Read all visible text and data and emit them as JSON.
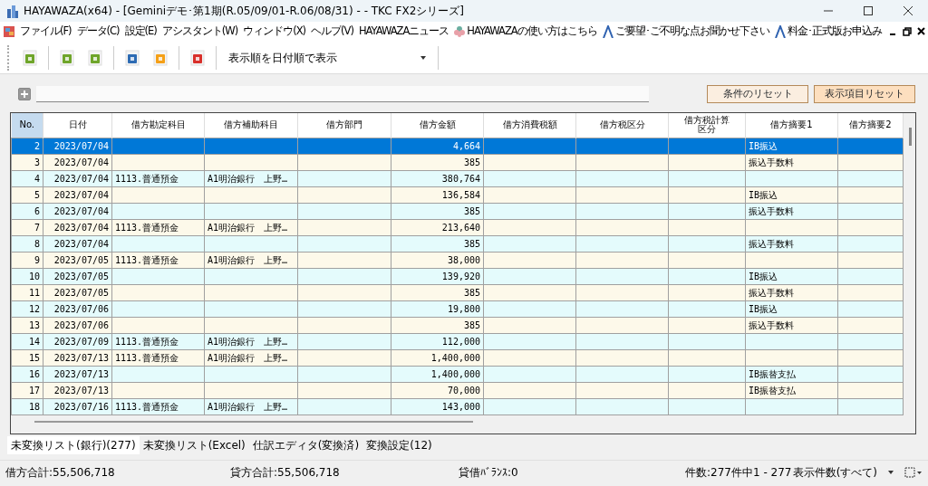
{
  "window": {
    "title": "HAYAWAZA(x64) - [Geminiデモ･第1期(R.05/09/01-R.06/08/31) -  - TKC FX2シリーズ]"
  },
  "menu": [
    {
      "label": "ファイル(F)",
      "kind": "text"
    },
    {
      "label": "データ(C)",
      "kind": "text"
    },
    {
      "label": "設定(E)",
      "kind": "text"
    },
    {
      "label": "アシスタント(W)",
      "kind": "text"
    },
    {
      "label": "ウィンドウ(X)",
      "kind": "text"
    },
    {
      "label": "ヘルプ(V)",
      "kind": "text"
    },
    {
      "label": "HAYAWAZAニュース",
      "kind": "text"
    },
    {
      "label": "HAYAWAZAの使い方はこちら",
      "kind": "flower"
    },
    {
      "label": "ご要望･ご不明な点お聞かせ下さい",
      "kind": "logo"
    },
    {
      "label": "料金･正式版お申込み",
      "kind": "logo"
    }
  ],
  "toolbar": {
    "sort_select": "表示順を日付順で表示"
  },
  "filter": {
    "reset_conditions": "条件のリセット",
    "reset_columns": "表示項目リセット"
  },
  "table": {
    "columns": [
      "No.",
      "日付",
      "借方勘定科目",
      "借方補助科目",
      "借方部門",
      "借方金額",
      "借方消費税額",
      "借方税区分",
      "借方税計算区分",
      "借方摘要1",
      "借方摘要2"
    ],
    "rows": [
      {
        "no": "2",
        "date": "2023/07/04",
        "account": "",
        "sub": "",
        "amount": "4,664",
        "memo": "IB振込",
        "selected": true
      },
      {
        "no": "3",
        "date": "2023/07/04",
        "account": "",
        "sub": "",
        "amount": "385",
        "memo": "振込手数料",
        "selected": false
      },
      {
        "no": "4",
        "date": "2023/07/04",
        "account": "1113.普通預金",
        "sub": "A1明治銀行　上野…",
        "amount": "380,764",
        "memo": "",
        "selected": false
      },
      {
        "no": "5",
        "date": "2023/07/04",
        "account": "",
        "sub": "",
        "amount": "136,584",
        "memo": "IB振込",
        "selected": false
      },
      {
        "no": "6",
        "date": "2023/07/04",
        "account": "",
        "sub": "",
        "amount": "385",
        "memo": "振込手数料",
        "selected": false
      },
      {
        "no": "7",
        "date": "2023/07/04",
        "account": "1113.普通預金",
        "sub": "A1明治銀行　上野…",
        "amount": "213,640",
        "memo": "",
        "selected": false
      },
      {
        "no": "8",
        "date": "2023/07/04",
        "account": "",
        "sub": "",
        "amount": "385",
        "memo": "振込手数料",
        "selected": false
      },
      {
        "no": "9",
        "date": "2023/07/05",
        "account": "1113.普通預金",
        "sub": "A1明治銀行　上野…",
        "amount": "38,000",
        "memo": "",
        "selected": false
      },
      {
        "no": "10",
        "date": "2023/07/05",
        "account": "",
        "sub": "",
        "amount": "139,920",
        "memo": "IB振込",
        "selected": false
      },
      {
        "no": "11",
        "date": "2023/07/05",
        "account": "",
        "sub": "",
        "amount": "385",
        "memo": "振込手数料",
        "selected": false
      },
      {
        "no": "12",
        "date": "2023/07/06",
        "account": "",
        "sub": "",
        "amount": "19,800",
        "memo": "IB振込",
        "selected": false
      },
      {
        "no": "13",
        "date": "2023/07/06",
        "account": "",
        "sub": "",
        "amount": "385",
        "memo": "振込手数料",
        "selected": false
      },
      {
        "no": "14",
        "date": "2023/07/09",
        "account": "1113.普通預金",
        "sub": "A1明治銀行　上野…",
        "amount": "112,000",
        "memo": "",
        "selected": false
      },
      {
        "no": "15",
        "date": "2023/07/13",
        "account": "1113.普通預金",
        "sub": "A1明治銀行　上野…",
        "amount": "1,400,000",
        "memo": "",
        "selected": false
      },
      {
        "no": "16",
        "date": "2023/07/13",
        "account": "",
        "sub": "",
        "amount": "1,400,000",
        "memo": "IB振替支払",
        "selected": false
      },
      {
        "no": "17",
        "date": "2023/07/13",
        "account": "",
        "sub": "",
        "amount": "70,000",
        "memo": "IB振替支払",
        "selected": false
      },
      {
        "no": "18",
        "date": "2023/07/16",
        "account": "1113.普通預金",
        "sub": "A1明治銀行　上野…",
        "amount": "143,000",
        "memo": "",
        "selected": false
      }
    ]
  },
  "tabs": [
    {
      "label": "未変換リスト(銀行)(277)",
      "selected": true
    },
    {
      "label": "未変換リスト(Excel)",
      "selected": false
    },
    {
      "label": "仕訳エディタ(変換済)",
      "selected": false
    },
    {
      "label": "変換設定(12)",
      "selected": false
    }
  ],
  "status_bar": {
    "debit_total": "借方合計:55,506,718",
    "credit_total": "貸方合計:55,506,718",
    "balance": "貸借ﾊﾞﾗﾝｽ:0",
    "count": "件数:277件中1 - 277",
    "page_size": "表示件数(すべて)"
  }
}
